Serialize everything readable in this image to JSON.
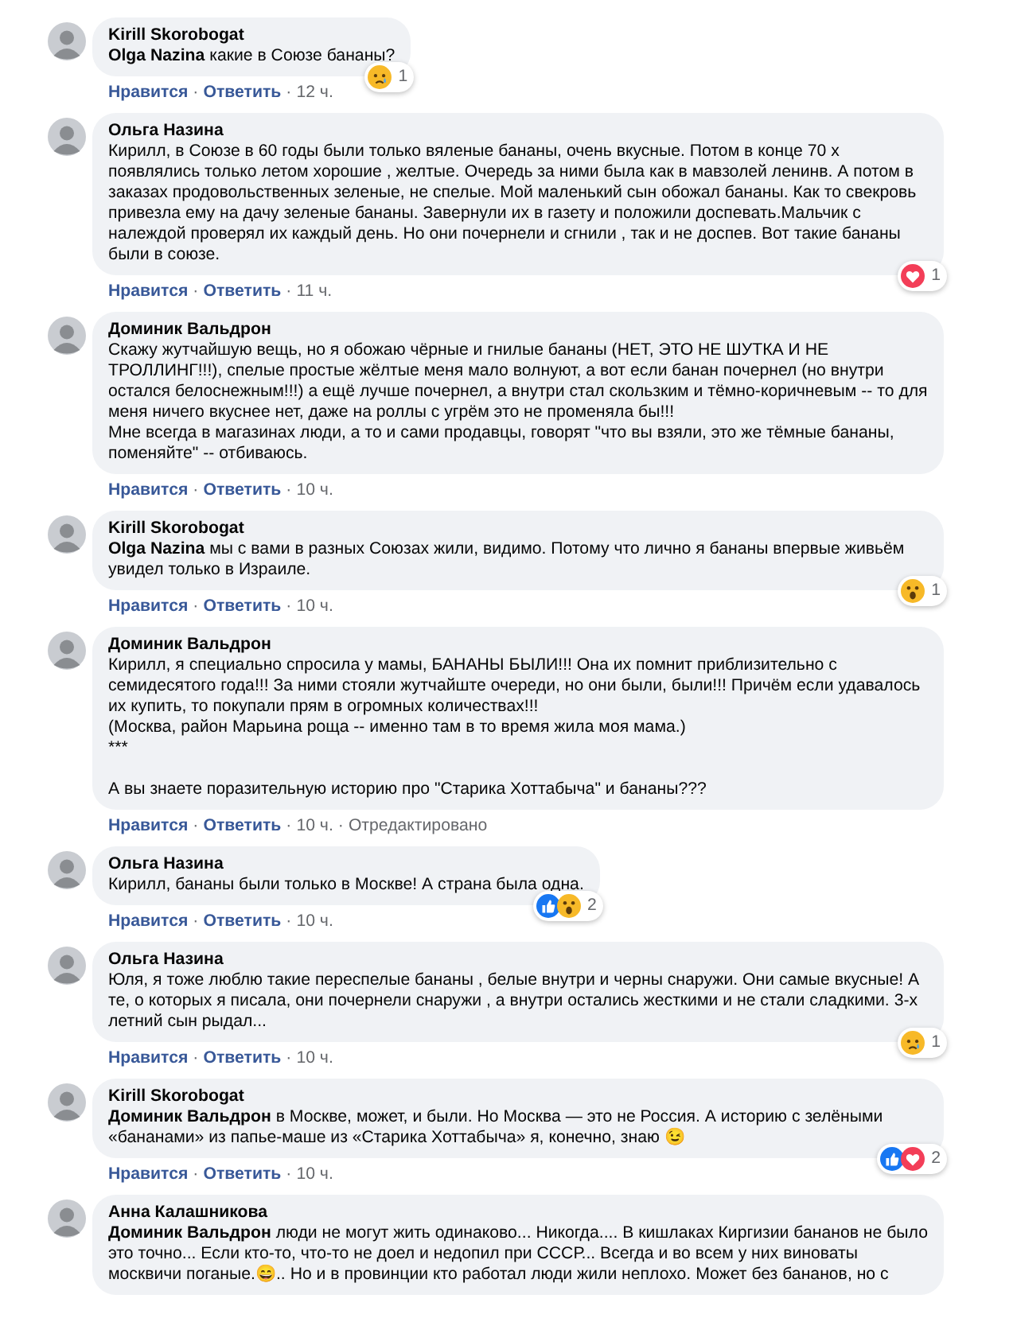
{
  "comments": [
    {
      "author": "Kirill Skorobogat",
      "text": "**Olga Nazina** какие в Союзе бананы?",
      "footer": [
        {
          "kind": "link",
          "text": "Нравится"
        },
        {
          "kind": "sep",
          "text": "·"
        },
        {
          "kind": "link",
          "text": "Ответить"
        },
        {
          "kind": "sep",
          "text": "·"
        },
        {
          "kind": "time",
          "text": "12 ч."
        }
      ],
      "reactions": [
        {
          "kind": "sad"
        }
      ],
      "reaction_count": "1"
    },
    {
      "author": "Ольга Назина",
      "text": "Кирилл, в Союзе в 60 годы были только вяленые бананы, очень вкусные. Потом в конце 70 х появлялись только летом хорошие , желтые. Очередь за ними была как в мавзолей ленинв. А потом в заказах продовольственных зеленые, не спелые. Мой маленький сын обожал бананы. Как то свекровь привезла ему на дачу зеленые бананы. Завернули их в газету и положили доспевать.Мальчик с належдой проверял их каждый день. Но они почернели и сгнили , так и не доспев. Вот такие бананы были в союзе.",
      "footer": [
        {
          "kind": "link",
          "text": "Нравится"
        },
        {
          "kind": "sep",
          "text": "·"
        },
        {
          "kind": "link",
          "text": "Ответить"
        },
        {
          "kind": "sep",
          "text": "·"
        },
        {
          "kind": "time",
          "text": "11 ч."
        }
      ],
      "reactions": [
        {
          "kind": "love"
        }
      ],
      "reaction_count": "1"
    },
    {
      "author": "Доминик Вальдрон",
      "text": "Скажу жутчайшую вещь, но я обожаю чёрные и гнилые бананы (НЕТ, ЭТО НЕ ШУТКА И НЕ ТРОЛЛИНГ!!!), спелые простые жёлтые меня мало волнуют, а вот если банан почернел (но внутри остался белоснежным!!!) а ещё лучше почернел, а внутри стал скользким и тёмно-коричневым -- то для меня ничего вкуснее нет, даже на роллы с угрём это не променяла бы!!!\nМне всегда в магазинах люди, а то и сами продавцы, говорят \"что вы взяли, это же тёмные бананы, поменяйте\" -- отбиваюсь.",
      "footer": [
        {
          "kind": "link",
          "text": "Нравится"
        },
        {
          "kind": "sep",
          "text": "·"
        },
        {
          "kind": "link",
          "text": "Ответить"
        },
        {
          "kind": "sep",
          "text": "·"
        },
        {
          "kind": "time",
          "text": "10 ч."
        }
      ]
    },
    {
      "author": "Kirill Skorobogat",
      "text": "**Olga Nazina** мы с вами в разных Союзах жили, видимо. Потому что лично я бананы впервые живьём увидел только в Израиле.",
      "footer": [
        {
          "kind": "link",
          "text": "Нравится"
        },
        {
          "kind": "sep",
          "text": "·"
        },
        {
          "kind": "link",
          "text": "Ответить"
        },
        {
          "kind": "sep",
          "text": "·"
        },
        {
          "kind": "time",
          "text": "10 ч."
        }
      ],
      "reactions": [
        {
          "kind": "wow"
        }
      ],
      "reaction_count": "1"
    },
    {
      "author": "Доминик Вальдрон",
      "text": "Кирилл, я специально спросила у мамы, БАНАНЫ БЫЛИ!!! Она их помнит приблизительно с семидесятого года!!! За ними стояли жутчайште очереди, но они были, были!!! Причём если удавалось их купить, то покупали прям в огромных количествах!!!\n(Москва, район Марьина роща -- именно там в то время жила моя мама.)\n***\n\nА вы знаете поразительную историю про \"Старика Хоттабыча\" и бананы???",
      "footer": [
        {
          "kind": "link",
          "text": "Нравится"
        },
        {
          "kind": "sep",
          "text": "·"
        },
        {
          "kind": "link",
          "text": "Ответить"
        },
        {
          "kind": "sep",
          "text": "·"
        },
        {
          "kind": "time",
          "text": "10 ч."
        },
        {
          "kind": "sep",
          "text": "·"
        },
        {
          "kind": "time",
          "text": "Отредактировано"
        }
      ]
    },
    {
      "author": "Ольга Назина",
      "text": "Кирилл, бананы были только в Москве! А страна была одна.",
      "footer": [
        {
          "kind": "link",
          "text": "Нравится"
        },
        {
          "kind": "sep",
          "text": "·"
        },
        {
          "kind": "link",
          "text": "Ответить"
        },
        {
          "kind": "sep",
          "text": "·"
        },
        {
          "kind": "time",
          "text": "10 ч."
        }
      ],
      "reactions": [
        {
          "kind": "like"
        },
        {
          "kind": "wow"
        }
      ],
      "reaction_count": "2"
    },
    {
      "author": "Ольга Назина",
      "text": "Юля, я тоже люблю такие переспелые бананы , белые внутри и черны снаружи. Они самые вкусные! А те, о которых я писала, они почернели снаружи , а внутри остались жесткими и не стали сладкими. 3-х летний сын рыдал...",
      "footer": [
        {
          "kind": "link",
          "text": "Нравится"
        },
        {
          "kind": "sep",
          "text": "·"
        },
        {
          "kind": "link",
          "text": "Ответить"
        },
        {
          "kind": "sep",
          "text": "·"
        },
        {
          "kind": "time",
          "text": "10 ч."
        }
      ],
      "reactions": [
        {
          "kind": "sad"
        }
      ],
      "reaction_count": "1"
    },
    {
      "author": "Kirill Skorobogat",
      "text": "**Доминик Вальдрон** в Москве, может, и были. Но Москва — это не Россия. А историю с зелёными «бананами» из папье-маше из «Старика Хоттабыча» я, конечно, знаю 😉",
      "footer": [
        {
          "kind": "link",
          "text": "Нравится"
        },
        {
          "kind": "sep",
          "text": "·"
        },
        {
          "kind": "link",
          "text": "Ответить"
        },
        {
          "kind": "sep",
          "text": "·"
        },
        {
          "kind": "time",
          "text": "10 ч."
        }
      ],
      "reactions": [
        {
          "kind": "like"
        },
        {
          "kind": "love"
        }
      ],
      "reaction_count": "2"
    },
    {
      "author": "Анна Калашникова",
      "text": "**Доминик Вальдрон** люди не могут жить одинаково... Никогда.... В кишлаках Киргизии бананов не было это точно... Если кто-то, что-то не доел и недопил при СССР... Всегда и во всем у них виноваты москвичи поганые.😄.. Но и в провинции кто работал люди жили неплохо. Может без бананов, но с"
    }
  ]
}
